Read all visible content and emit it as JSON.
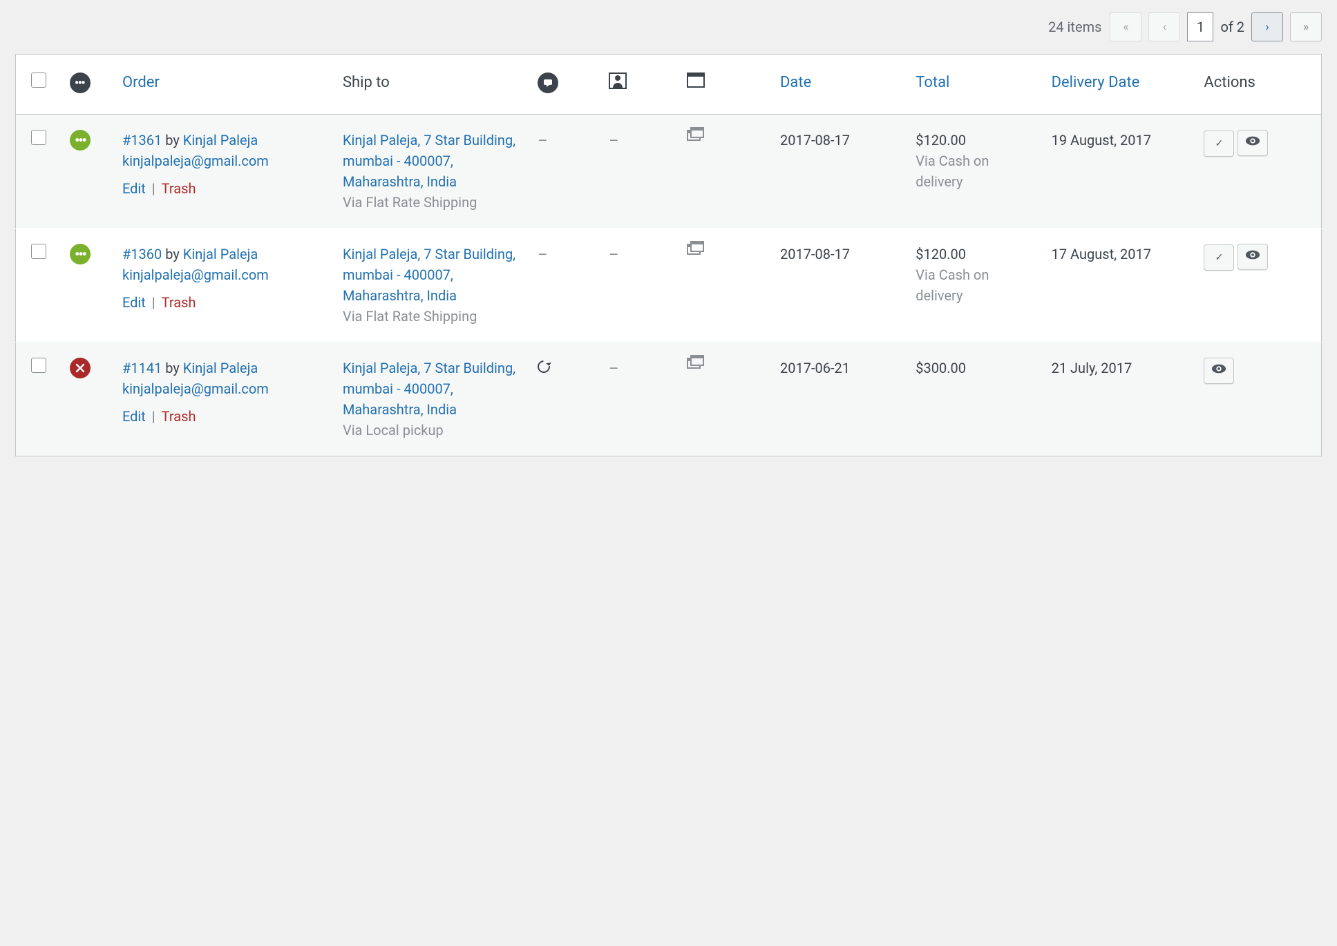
{
  "pagination": {
    "items_label": "24 items",
    "current_page": "1",
    "total_label": "of 2"
  },
  "columns": {
    "order": "Order",
    "ship_to": "Ship to",
    "date": "Date",
    "total": "Total",
    "delivery_date": "Delivery Date",
    "actions": "Actions"
  },
  "labels": {
    "by": "by",
    "edit": "Edit",
    "trash": "Trash",
    "separator": "|"
  },
  "orders": [
    {
      "status": "processing",
      "order_id": "#1361",
      "customer_name": "Kinjal Paleja",
      "customer_email": "kinjalpaleja@gmail.com",
      "ship_to": "Kinjal Paleja, 7 Star Building, mumbai - 400007, Maharashtra, India",
      "ship_via": "Via Flat Rate Shipping",
      "notes": "–",
      "customer_col": "–",
      "billing_icon": true,
      "date": "2017-08-17",
      "total": "$120.00",
      "payment_via": "Via Cash on delivery",
      "delivery_date": "19 August, 2017",
      "action_complete": true,
      "action_view": true,
      "action_retry": false
    },
    {
      "status": "processing",
      "order_id": "#1360",
      "customer_name": "Kinjal Paleja",
      "customer_email": "kinjalpaleja@gmail.com",
      "ship_to": "Kinjal Paleja, 7 Star Building, mumbai - 400007, Maharashtra, India",
      "ship_via": "Via Flat Rate Shipping",
      "notes": "–",
      "customer_col": "–",
      "billing_icon": true,
      "date": "2017-08-17",
      "total": "$120.00",
      "payment_via": "Via Cash on delivery",
      "delivery_date": "17 August, 2017",
      "action_complete": true,
      "action_view": true,
      "action_retry": false
    },
    {
      "status": "cancelled",
      "order_id": "#1141",
      "customer_name": "Kinjal Paleja",
      "customer_email": "kinjalpaleja@gmail.com",
      "ship_to": "Kinjal Paleja, 7 Star Building, mumbai - 400007, Maharashtra, India",
      "ship_via": "Via Local pickup",
      "notes": "retry",
      "customer_col": "–",
      "billing_icon": true,
      "date": "2017-06-21",
      "total": "$300.00",
      "payment_via": "",
      "delivery_date": "21 July, 2017",
      "action_complete": false,
      "action_view": true,
      "action_retry": false
    }
  ]
}
